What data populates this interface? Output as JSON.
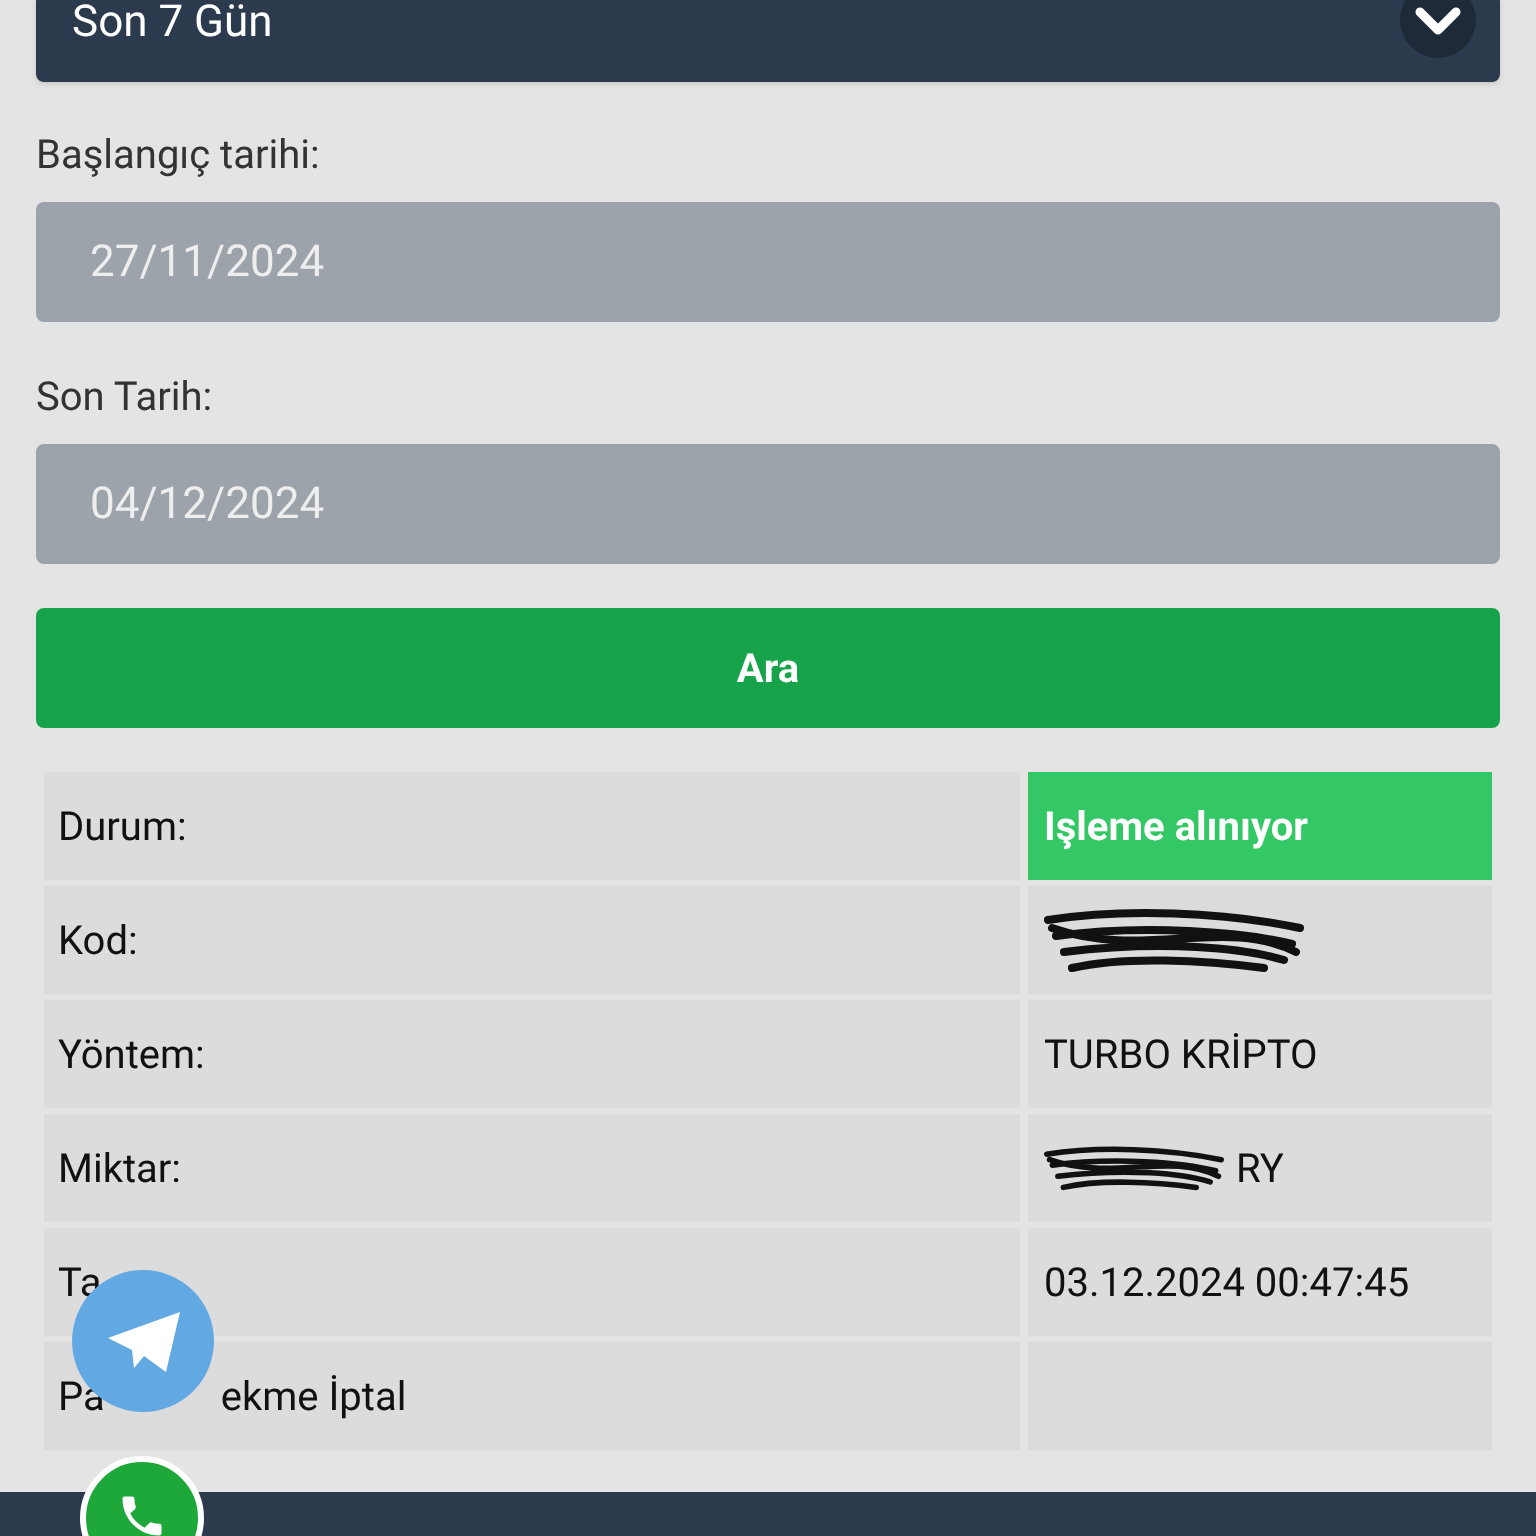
{
  "period_select": {
    "value": "Son 7 Gün"
  },
  "start_date": {
    "label": "Başlangıç tarihi:",
    "value": "27/11/2024"
  },
  "end_date": {
    "label": "Son Tarih:",
    "value": "04/12/2024"
  },
  "search_button": "Ara",
  "details": [
    {
      "kind": "status",
      "label": "Durum:",
      "value": "Işleme alınıyor"
    },
    {
      "kind": "redacted",
      "label": "Kod:"
    },
    {
      "kind": "text",
      "label": "Yöntem:",
      "value": "TURBO KRİPTO"
    },
    {
      "kind": "partly_redacted",
      "label": "Miktar:",
      "value": "RY"
    },
    {
      "kind": "text",
      "label": "Ta",
      "value": "03.12.2024 00:47:45"
    },
    {
      "kind": "split",
      "label": "Pa",
      "label_rest": "ekme İptal"
    }
  ]
}
